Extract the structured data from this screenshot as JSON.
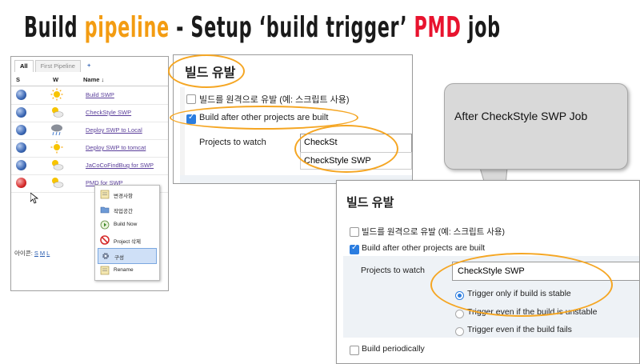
{
  "title": {
    "part1": "Build ",
    "part2": "pipeline",
    "part3": " - Setup ‘build trigger’ ",
    "part4": "PMD",
    "part5": " job"
  },
  "colors": {
    "title_dark": "#1a1a1a",
    "title_orange": "#f39c12",
    "title_red": "#e8132e",
    "highlight": "#f5a623",
    "checkbox_blue": "#2b7de0"
  },
  "dashboard": {
    "tabs": [
      "All",
      "First Pipeline",
      "+"
    ],
    "headers": {
      "s": "S",
      "w": "W",
      "name": "Name ↓"
    },
    "jobs": [
      {
        "name": "Build SWP",
        "status": "blue",
        "weather": "sunny-icon"
      },
      {
        "name": "CheckStyle SWP",
        "status": "blue",
        "weather": "partly-cloudy-icon"
      },
      {
        "name": "Deploy SWP to Local",
        "status": "blue",
        "weather": "storm-icon"
      },
      {
        "name": "Deploy SWP to tomcat",
        "status": "blue",
        "weather": "sunny-icon"
      },
      {
        "name": "JaCoCoFindBug for SWP",
        "status": "blue",
        "weather": "partly-cloudy-icon"
      },
      {
        "name": "PMD for SWP",
        "status": "red",
        "weather": "partly-cloudy-icon"
      }
    ],
    "icon_legend": {
      "label": "아이콘:",
      "s": "S",
      "m": "M",
      "l": "L"
    },
    "context_menu": [
      "변경사항",
      "작업공간",
      "Build Now",
      "Project 삭제",
      "구성",
      "Rename"
    ]
  },
  "config1": {
    "section": "빌드 유발",
    "remote": "빌드를 원격으로 유발 (예: 스크립트 사용)",
    "after_other": "Build after other projects are built",
    "projects_label": "Projects to watch",
    "input_value": "CheckSt",
    "suggestion": "CheckStyle SWP"
  },
  "callout": {
    "text": "After CheckStyle SWP Job"
  },
  "config2": {
    "section": "빌드 유발",
    "remote": "빌드를 원격으로 유발 (예: 스크립트 사용)",
    "after_other": "Build after other projects are built",
    "projects_label": "Projects to watch",
    "input_value": "CheckStyle SWP",
    "trigger_stable": "Trigger only if build is stable",
    "trigger_unstable": "Trigger even if the build is unstable",
    "trigger_fails": "Trigger even if the build fails",
    "build_periodically": "Build periodically"
  }
}
